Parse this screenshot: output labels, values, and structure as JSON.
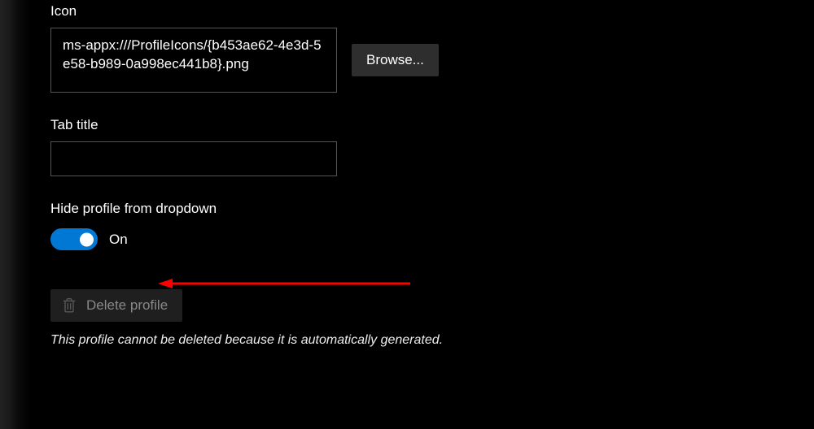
{
  "icon_section": {
    "label": "Icon",
    "path_value": "ms-appx:///ProfileIcons/{b453ae62-4e3d-5e58-b989-0a998ec441b8}.png",
    "browse_label": "Browse..."
  },
  "tab_title_section": {
    "label": "Tab title",
    "value": ""
  },
  "hide_profile_section": {
    "label": "Hide profile from dropdown",
    "toggle_state_label": "On",
    "toggle_on": true
  },
  "delete_section": {
    "button_label": "Delete profile",
    "note": "This profile cannot be deleted because it is automatically generated."
  },
  "colors": {
    "toggle_on": "#0078d4",
    "arrow": "#ff0000"
  }
}
